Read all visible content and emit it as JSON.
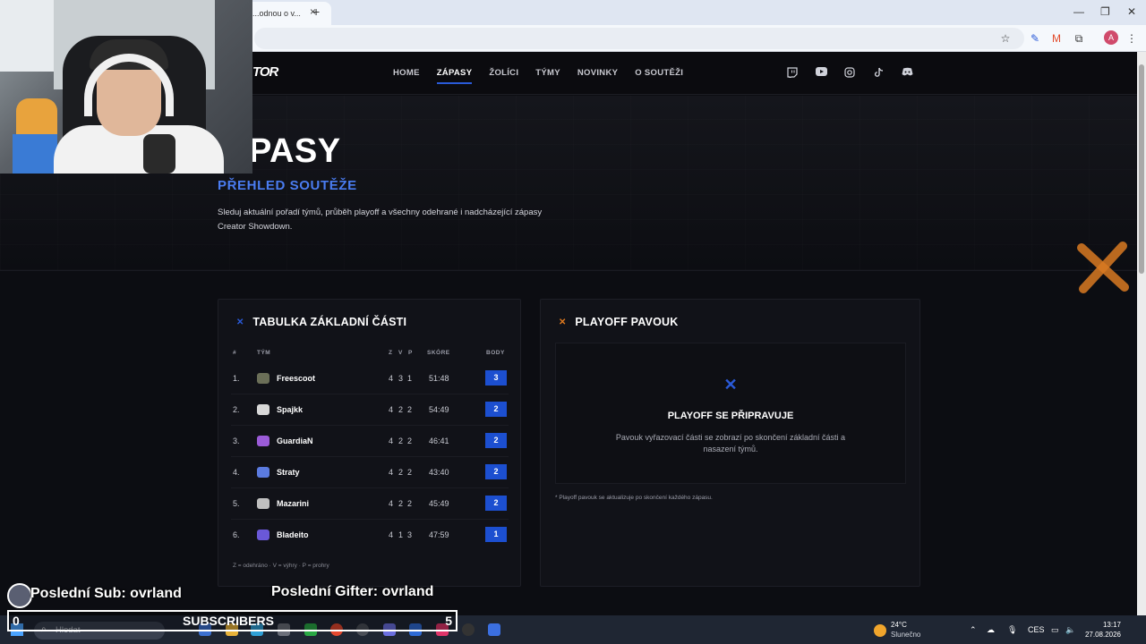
{
  "browser": {
    "tab_title": "...odnou o v...",
    "tab_close": "×",
    "new_tab": "+",
    "win_min": "—",
    "win_max": "❐",
    "win_close": "✕",
    "profile_initial": "A"
  },
  "site": {
    "logo": "TOR",
    "nav": [
      "HOME",
      "ZÁPASY",
      "ŽOLÍCI",
      "TÝMY",
      "NOVINKY",
      "O SOUTĚŽI"
    ],
    "active_nav": "ZÁPASY",
    "socials": [
      "twitch-icon",
      "youtube-icon",
      "instagram-icon",
      "tiktok-icon",
      "discord-icon"
    ],
    "hero": {
      "title": "ÁPASY",
      "subtitle": "PŘEHLED SOUTĚŽE",
      "description": "Sleduj aktuální pořadí týmů, průběh playoff a všechny odehrané i nadcházející zápasy Creator Showdown."
    },
    "standings": {
      "title": "TABULKA ZÁKLADNÍ ČÁSTI",
      "headers": {
        "rank": "#",
        "team": "TÝM",
        "z": "Z",
        "v": "V",
        "p": "P",
        "score": "SKÓRE",
        "points": "BODY"
      },
      "rows": [
        {
          "rank": "1.",
          "team": "Freescoot",
          "z": "4",
          "v": "3",
          "p": "1",
          "score": "51:48",
          "points": "3",
          "icon_color": "#6b6f58"
        },
        {
          "rank": "2.",
          "team": "Spajkk",
          "z": "4",
          "v": "2",
          "p": "2",
          "score": "54:49",
          "points": "2",
          "icon_color": "#d8d8d8"
        },
        {
          "rank": "3.",
          "team": "GuardiaN",
          "z": "4",
          "v": "2",
          "p": "2",
          "score": "46:41",
          "points": "2",
          "icon_color": "#9b5bd8"
        },
        {
          "rank": "4.",
          "team": "Straty",
          "z": "4",
          "v": "2",
          "p": "2",
          "score": "43:40",
          "points": "2",
          "icon_color": "#5b7be0"
        },
        {
          "rank": "5.",
          "team": "Mazarini",
          "z": "4",
          "v": "2",
          "p": "2",
          "score": "45:49",
          "points": "2",
          "icon_color": "#bfbfbf"
        },
        {
          "rank": "6.",
          "team": "Bladeito",
          "z": "4",
          "v": "1",
          "p": "3",
          "score": "47:59",
          "points": "1",
          "icon_color": "#6a58d8"
        }
      ],
      "legend": "Z = odehráno  ·  V = výhry  ·  P = prohry"
    },
    "playoff": {
      "title": "PLAYOFF PAVOUK",
      "state_title": "PLAYOFF SE PŘIPRAVUJE",
      "state_desc": "Pavouk vyřazovací části se zobrazí po skončení základní části a nasazení týmů.",
      "note": "* Playoff pavouk se aktualizuje po skončení každého zápasu."
    }
  },
  "overlay": {
    "last_sub": "Poslední Sub: ovrland",
    "last_gifter": "Poslední Gifter: ovrland",
    "sub_count_left": "0",
    "sub_label": "SUBSCRIBERS",
    "sub_count_right": "5"
  },
  "taskbar": {
    "search_placeholder": "Hledat",
    "weather_temp": "24°C",
    "weather_desc": "Slunečno",
    "lang": "CES",
    "time": "13:17",
    "date": "27.08.2026"
  },
  "colors": {
    "accent_blue": "#2a5ad8",
    "accent_orange": "#e07a1f",
    "points_badge": "#1c4fd0"
  }
}
